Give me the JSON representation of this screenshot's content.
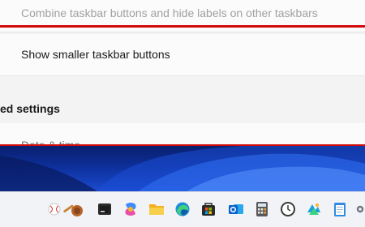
{
  "settings": {
    "combine_label": "Combine taskbar buttons and hide labels on other taskbars",
    "smaller_label": "Show smaller taskbar buttons",
    "section_title": "ed settings",
    "datetime_label": "Date & time"
  },
  "colors": {
    "highlight": "#d10a0a",
    "wallpaper": "#0d2f9a"
  },
  "taskbar": {
    "icons": [
      "widgets-sports-icon",
      "terminal-icon",
      "copilot-icon",
      "file-explorer-icon",
      "edge-icon",
      "store-icon",
      "outlook-icon",
      "calculator-icon",
      "clock-icon",
      "photos-icon",
      "notepad-icon",
      "settings-icon"
    ]
  }
}
